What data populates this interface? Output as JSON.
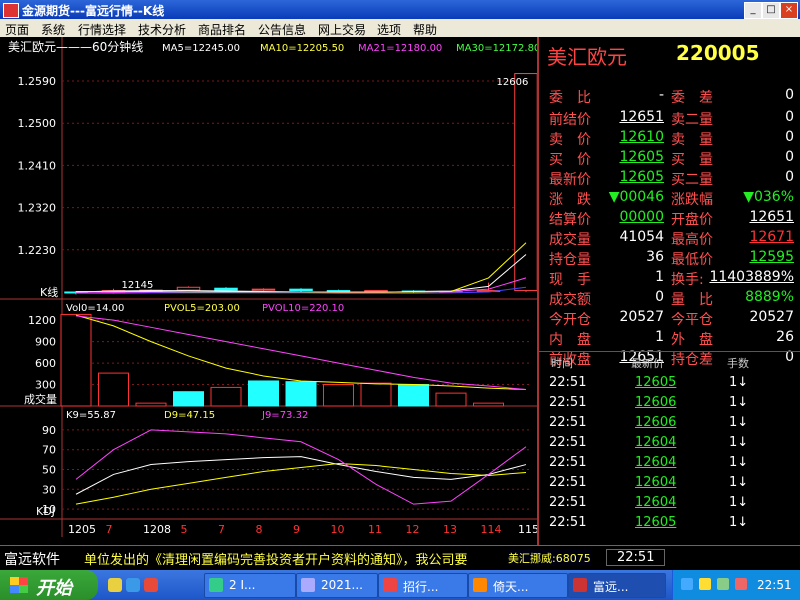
{
  "window": {
    "title": "金源期货---富远行情--K线",
    "controls": {
      "minimize": "_",
      "maximize": "□",
      "close": "×"
    }
  },
  "menu": [
    "页面",
    "系统",
    "行情选择",
    "技术分析",
    "商品排名",
    "公告信息",
    "网上交易",
    "选项",
    "帮助"
  ],
  "chart_data": [
    {
      "type": "line",
      "panel": "kline",
      "title": "美汇欧元———60分钟线",
      "indicators": [
        "MA5=12245.00",
        "MA10=12205.50",
        "MA21=12180.00",
        "MA30=12172.80"
      ],
      "ylabel": "K线",
      "y_ticks": [
        "1.2590",
        "1.2500",
        "1.2410",
        "1.2320",
        "1.2230"
      ],
      "ylim": [
        1.2125,
        1.262
      ],
      "annotations": [
        "12606",
        "12145"
      ],
      "series": [
        {
          "name": "MA5",
          "color": "#ffffff",
          "values": [
            1.214,
            1.2142,
            1.2143,
            1.2143,
            1.2142,
            1.2141,
            1.214,
            1.2139,
            1.2139,
            1.2141,
            1.2142,
            1.2152,
            1.222
          ]
        },
        {
          "name": "MA10",
          "color": "#ff44ff",
          "values": [
            1.2138,
            1.2139,
            1.214,
            1.214,
            1.214,
            1.214,
            1.2139,
            1.2139,
            1.2139,
            1.214,
            1.2141,
            1.2146,
            1.217
          ]
        },
        {
          "name": "MA21",
          "color": "#ffff00",
          "values": [
            1.2141,
            1.2141,
            1.2141,
            1.214,
            1.214,
            1.214,
            1.214,
            1.214,
            1.214,
            1.214,
            1.2141,
            1.217,
            1.2245
          ]
        },
        {
          "name": "MA30",
          "color": "#4444ff",
          "values": [
            1.2137,
            1.2137,
            1.2138,
            1.2138,
            1.2138,
            1.2138,
            1.2138,
            1.2137,
            1.2137,
            1.2137,
            1.2138,
            1.214,
            1.215
          ]
        }
      ],
      "candles": [
        {
          "open": 1.214,
          "close": 1.2138,
          "high": 1.2142,
          "low": 1.2135,
          "up": false
        },
        {
          "open": 1.2138,
          "close": 1.2143,
          "high": 1.2147,
          "low": 1.2136,
          "up": true
        },
        {
          "open": 1.2141,
          "close": 1.2144,
          "high": 1.2146,
          "low": 1.2139,
          "up": true
        },
        {
          "open": 1.2144,
          "close": 1.215,
          "high": 1.2152,
          "low": 1.2142,
          "up": true
        },
        {
          "open": 1.2148,
          "close": 1.2144,
          "high": 1.215,
          "low": 1.2142,
          "up": false
        },
        {
          "open": 1.2144,
          "close": 1.2146,
          "high": 1.2148,
          "low": 1.2142,
          "up": true
        },
        {
          "open": 1.2146,
          "close": 1.2143,
          "high": 1.2148,
          "low": 1.2141,
          "up": false
        },
        {
          "open": 1.2143,
          "close": 1.2141,
          "high": 1.2145,
          "low": 1.2139,
          "up": false
        },
        {
          "open": 1.2141,
          "close": 1.2143,
          "high": 1.2144,
          "low": 1.2139,
          "up": true
        },
        {
          "open": 1.2142,
          "close": 1.214,
          "high": 1.2144,
          "low": 1.2138,
          "up": false
        },
        {
          "open": 1.214,
          "close": 1.2141,
          "high": 1.2143,
          "low": 1.2139,
          "up": true
        },
        {
          "open": 1.2141,
          "close": 1.2143,
          "high": 1.216,
          "low": 1.2139,
          "up": true
        },
        {
          "open": 1.2143,
          "close": 1.2606,
          "high": 1.2606,
          "low": 1.214,
          "up": true
        }
      ]
    },
    {
      "type": "bar",
      "panel": "volume",
      "indicators": [
        "Vol0=14.00",
        "PVOL5=203.00",
        "PVOL10=220.10"
      ],
      "ylabel": "成交量",
      "y_ticks": [
        "1200",
        "900",
        "600",
        "300"
      ],
      "ylim": [
        0,
        1300
      ],
      "values": [
        1280,
        460,
        40,
        200,
        260,
        350,
        340,
        300,
        320,
        300,
        180,
        40
      ],
      "filled": [
        false,
        false,
        false,
        true,
        false,
        true,
        true,
        false,
        false,
        true,
        false,
        false
      ],
      "series": [
        {
          "name": "PVOL5",
          "color": "#ffff00",
          "values": [
            1270,
            1120,
            900,
            700,
            530,
            420,
            350,
            330,
            310,
            300,
            280,
            250,
            230
          ]
        },
        {
          "name": "PVOL10",
          "color": "#ff44ff",
          "values": [
            1260,
            1200,
            1100,
            1000,
            900,
            800,
            700,
            600,
            500,
            400,
            320,
            280,
            230
          ]
        }
      ]
    },
    {
      "type": "line",
      "panel": "kdj",
      "indicators": [
        "K9=55.87",
        "D9=47.15",
        "J9=73.32"
      ],
      "ylabel": "KDJ",
      "y_ticks": [
        "90",
        "70",
        "50",
        "30",
        "10"
      ],
      "ylim": [
        0,
        100
      ],
      "x_ticks": [
        "1205",
        "7",
        "1208",
        "5",
        "7",
        "8",
        "9",
        "10",
        "11",
        "12",
        "13",
        "114",
        "115"
      ],
      "series": [
        {
          "name": "K",
          "color": "#ffffff",
          "values": [
            25,
            45,
            55,
            58,
            60,
            62,
            63,
            55,
            48,
            42,
            40,
            45,
            55
          ]
        },
        {
          "name": "D",
          "color": "#ffff00",
          "values": [
            15,
            22,
            30,
            36,
            42,
            48,
            52,
            56,
            54,
            50,
            46,
            44,
            47
          ]
        },
        {
          "name": "J",
          "color": "#ff44ff",
          "values": [
            40,
            70,
            90,
            88,
            86,
            82,
            78,
            60,
            35,
            15,
            18,
            45,
            73
          ]
        }
      ]
    }
  ],
  "quote": {
    "name": "美汇欧元",
    "code": "220005",
    "rows": [
      {
        "l1": "委　比",
        "v1": "-",
        "l2": "委　差",
        "v2": "0"
      },
      {
        "l1": "前结价",
        "v1": "12651",
        "l2": "卖二量",
        "v2": "0"
      },
      {
        "l1": "卖　价",
        "v1": "12610",
        "l2": "卖　量",
        "v2": "0"
      },
      {
        "l1": "买　价",
        "v1": "12605",
        "l2": "买　量",
        "v2": "0"
      },
      {
        "l1": "最新价",
        "v1": "12605",
        "l2": "买二量",
        "v2": "0"
      },
      {
        "l1": "涨　跌",
        "v1": "▼00046",
        "l2": "涨跌幅",
        "v2": "▼036%"
      },
      {
        "l1": "结算价",
        "v1": "00000",
        "l2": "开盘价",
        "v2": "12651"
      },
      {
        "l1": "成交量",
        "v1": "41054",
        "l2": "最高价",
        "v2": "12671"
      },
      {
        "l1": "持仓量",
        "v1": "36",
        "l2": "最低价",
        "v2": "12595"
      },
      {
        "l1": "现　手",
        "v1": "1",
        "l2": "换手:",
        "v2": "11403889%"
      },
      {
        "l1": "成交额",
        "v1": "0",
        "l2": "量　比",
        "v2": "8889%"
      },
      {
        "l1": "今开仓",
        "v1": "20527",
        "l2": "今平仓",
        "v2": "20527"
      },
      {
        "l1": "内　盘",
        "v1": "1",
        "l2": "外　盘",
        "v2": "26"
      },
      {
        "l1": "前收盘",
        "v1": "12651",
        "l2": "持仓差",
        "v2": "0"
      }
    ],
    "ticks_header": {
      "time": "时间",
      "price": "最新价",
      "qty": "手数"
    },
    "ticks": [
      {
        "time": "22:51",
        "price": "12605",
        "qty": "1↓"
      },
      {
        "time": "22:51",
        "price": "12606",
        "qty": "1↓"
      },
      {
        "time": "22:51",
        "price": "12606",
        "qty": "1↓"
      },
      {
        "time": "22:51",
        "price": "12604",
        "qty": "1↓"
      },
      {
        "time": "22:51",
        "price": "12604",
        "qty": "1↓"
      },
      {
        "time": "22:51",
        "price": "12604",
        "qty": "1↓"
      },
      {
        "time": "22:51",
        "price": "12604",
        "qty": "1↓"
      },
      {
        "time": "22:51",
        "price": "12605",
        "qty": "1↓"
      }
    ]
  },
  "status": {
    "brand": "富远软件",
    "news": "单位发出的《清理闲置编码完善投资者开户资料的通知》，我公司要",
    "quoteline": "美汇挪威:68075",
    "clock": "22:51"
  },
  "taskbar": {
    "start": "开始",
    "tasks": [
      "2 I...",
      "2021...",
      "招行...",
      "倚天...",
      "富远..."
    ],
    "clock": "22:51"
  }
}
